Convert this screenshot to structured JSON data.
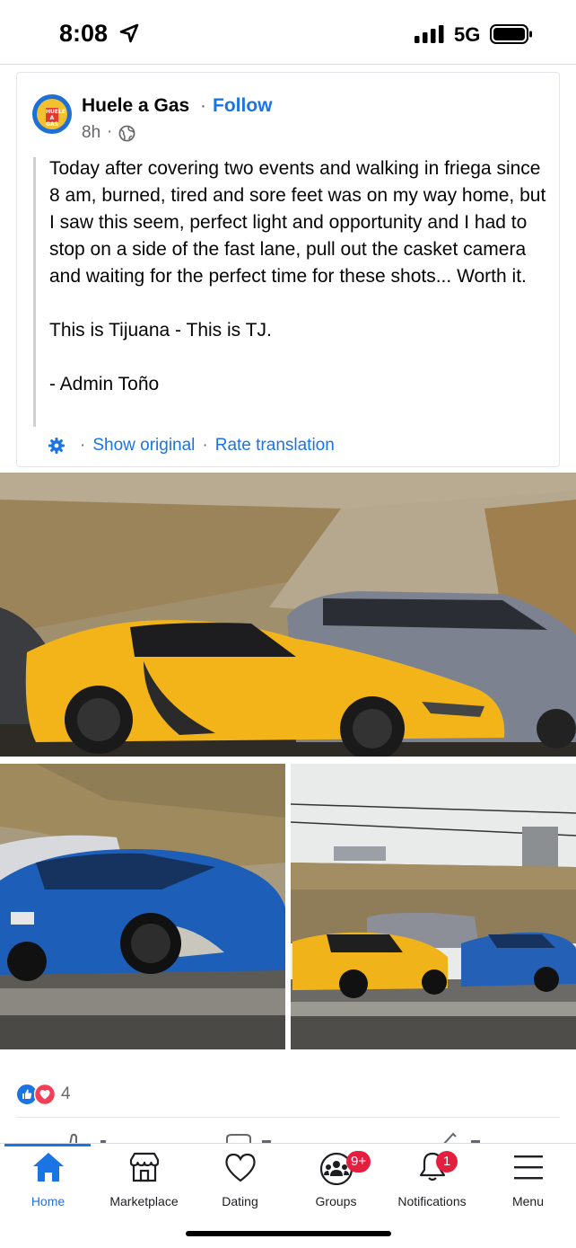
{
  "status_bar": {
    "time": "8:08",
    "network": "5G"
  },
  "post": {
    "page_name": "Huele a Gas",
    "separator": "·",
    "follow_label": "Follow",
    "time_ago": "8h",
    "avatar_text": "HUELE A GAS",
    "body_paragraphs": [
      "Today after covering two events and walking in friega since 8 am, burned, tired and sore feet was on my way home, but I saw this seem, perfect light and opportunity and I had to stop on a side of the fast lane, pull out the casket camera and waiting for the perfect time for these shots... Worth it.",
      "This is Tijuana - This is TJ.",
      "- Admin Toño"
    ],
    "show_original_label": "Show original",
    "rate_translation_label": "Rate translation",
    "reaction_count": "4",
    "icons": {
      "settings": "gear-icon",
      "privacy": "globe-icon"
    }
  },
  "nav": {
    "items": [
      {
        "label": "Home",
        "icon": "home-icon",
        "active": true
      },
      {
        "label": "Marketplace",
        "icon": "marketplace-icon"
      },
      {
        "label": "Dating",
        "icon": "dating-icon"
      },
      {
        "label": "Groups",
        "icon": "groups-icon",
        "badge": "9+"
      },
      {
        "label": "Notifications",
        "icon": "bell-icon",
        "badge": "1"
      },
      {
        "label": "Menu",
        "icon": "menu-icon"
      }
    ]
  },
  "colors": {
    "accent": "#1b74e4",
    "badge": "#e41e3f",
    "love": "#f33e58"
  }
}
